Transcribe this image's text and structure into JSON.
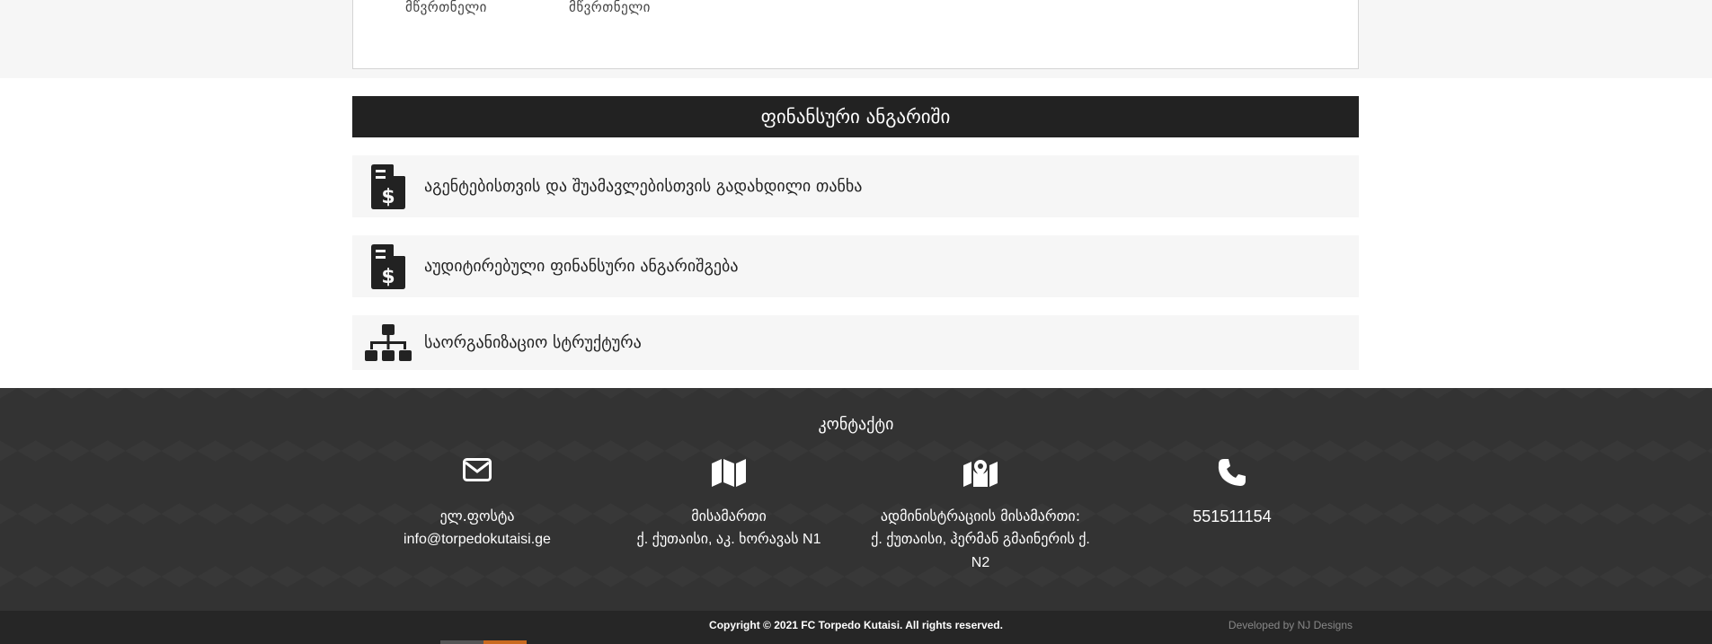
{
  "members": {
    "role_left": "მწვრთნელი",
    "role_right": "მწვრთნელი"
  },
  "finance": {
    "title": "ფინანსური ანგარიში",
    "items": [
      {
        "label": "აგენტებისთვის და შუამავლებისთვის გადახდილი თანხა",
        "icon": "file-invoice-dollar-icon"
      },
      {
        "label": "აუდიტირებული ფინანსური ანგარიშგება",
        "icon": "file-invoice-dollar-icon"
      },
      {
        "label": "საორგანიზაციო სტრუქტურა",
        "icon": "sitemap-icon"
      }
    ]
  },
  "contact": {
    "title": "კონტაქტი",
    "email_label": "ელ.ფოსტა",
    "email_value": "info@torpedokutaisi.ge",
    "address_label": "მისამართი",
    "address_value": "ქ. ქუთაისი, აკ. ხორავას N1",
    "admin_label": "ადმინისტრაციის მისამართი:",
    "admin_value_1": "ქ. ქუთაისი, ჰერმან გმაინერის ქ.",
    "admin_value_2": "N2",
    "phone_value": "551511154"
  },
  "footer": {
    "copyright": "Copyright © 2021 FC Torpedo Kutaisi. All rights reserved.",
    "developer": "Developed by NJ Designs"
  },
  "colors": {
    "header_bg": "#222222",
    "row_bg": "#f6f6f6",
    "contact_bg": "#333333",
    "footer_bg": "#262626",
    "accent": "#c96a1f"
  }
}
